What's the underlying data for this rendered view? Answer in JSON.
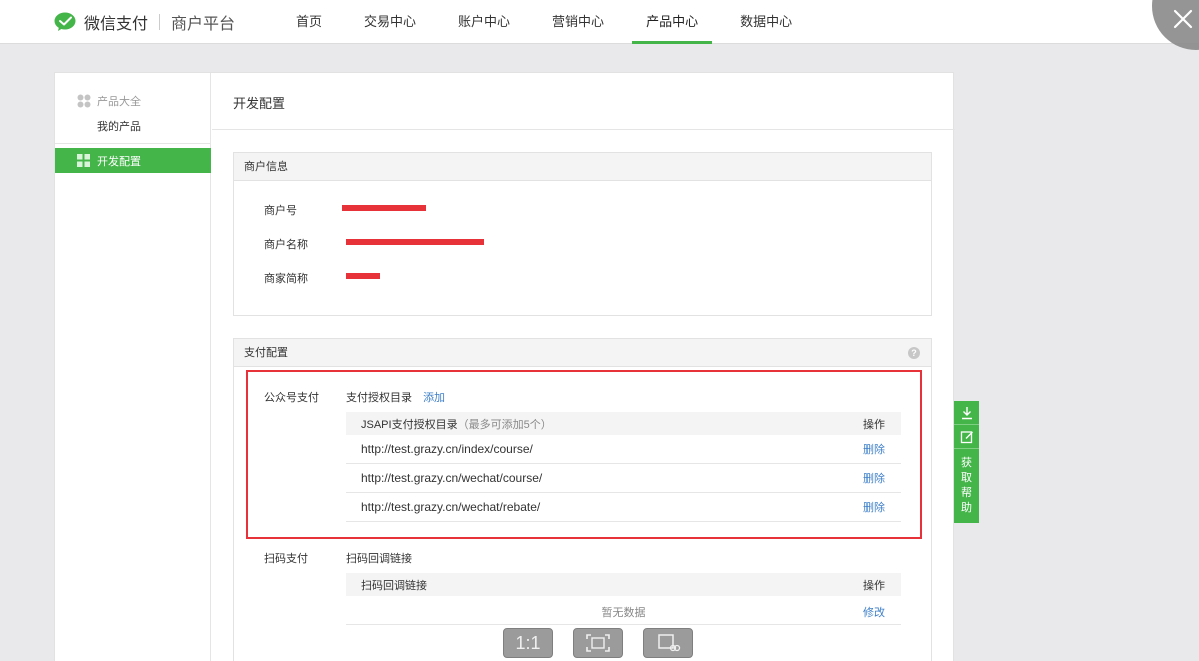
{
  "header": {
    "logo_text": "微信支付",
    "logo_sub": "商户平台",
    "nav": [
      {
        "label": "首页"
      },
      {
        "label": "交易中心"
      },
      {
        "label": "账户中心"
      },
      {
        "label": "营销中心"
      },
      {
        "label": "产品中心",
        "active": true
      },
      {
        "label": "数据中心"
      }
    ],
    "accent_color": "#44b549"
  },
  "sidebar": {
    "group_label": "产品大全",
    "sub_label": "我的产品",
    "active_label": "开发配置"
  },
  "page": {
    "title": "开发配置"
  },
  "merchant_info": {
    "title": "商户信息",
    "rows": [
      {
        "label": "商户号"
      },
      {
        "label": "商户名称"
      },
      {
        "label": "商家简称"
      }
    ]
  },
  "pay_config": {
    "title": "支付配置",
    "help": "?",
    "jsapi": {
      "section_label": "公众号支付",
      "dir_label": "支付授权目录",
      "add_label": "添加",
      "table_header": "JSAPI支付授权目录",
      "table_hint": "（最多可添加5个）",
      "op_header": "操作",
      "rows": [
        {
          "url": "http://test.grazy.cn/index/course/",
          "action": "删除"
        },
        {
          "url": "http://test.grazy.cn/wechat/course/",
          "action": "删除"
        },
        {
          "url": "http://test.grazy.cn/wechat/rebate/",
          "action": "删除"
        }
      ]
    },
    "native": {
      "section_label": "扫码支付",
      "link_label": "扫码回调链接",
      "table_header": "扫码回调链接",
      "op_header": "操作",
      "empty_text": "暂无数据",
      "edit_label": "修改"
    }
  },
  "float_tools": {
    "help_chars": [
      "获",
      "取",
      "帮",
      "助"
    ]
  },
  "viewer": {
    "actual_size_label": "1:1"
  }
}
